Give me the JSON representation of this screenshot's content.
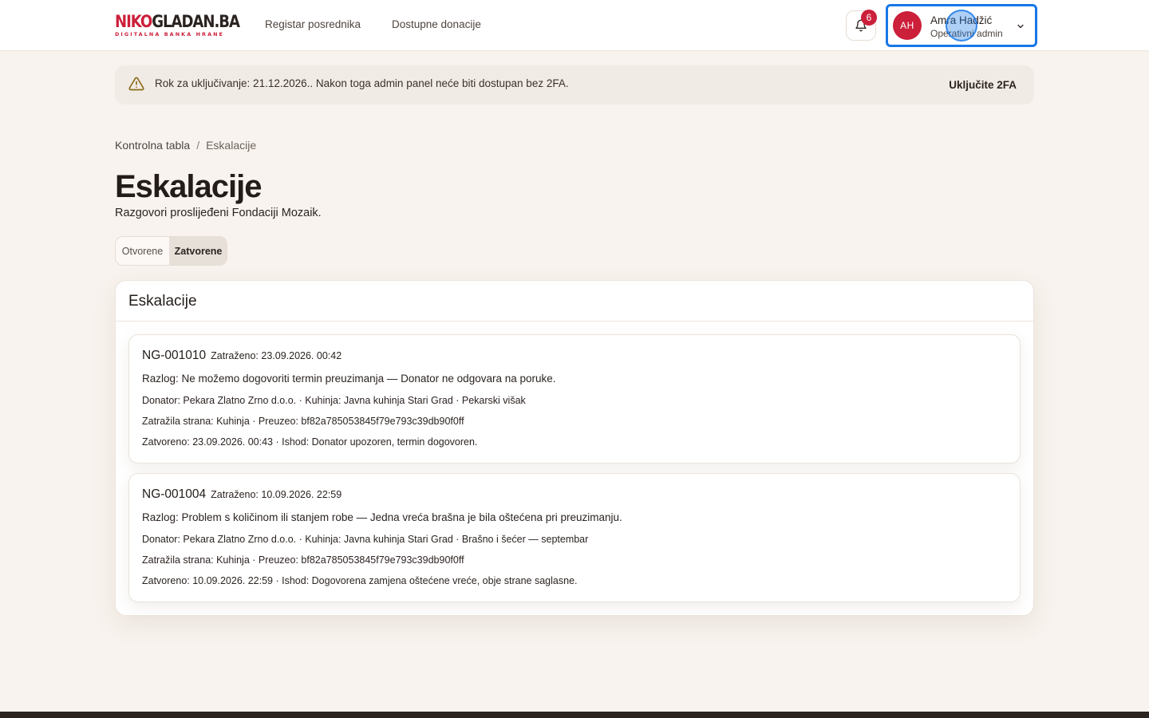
{
  "header": {
    "logo": {
      "part1": "NIKO",
      "part2": "GLADAN.BA",
      "tagline": "DIGITALNA BANKA HRANE"
    },
    "nav": [
      {
        "label": "Registar posrednika"
      },
      {
        "label": "Dostupne donacije"
      }
    ],
    "notifications": {
      "count": "6",
      "icon": "bell-icon"
    },
    "user": {
      "initials": "AH",
      "name": "Amra Hadžić",
      "role": "Operativni admin",
      "icon": "chevron-down-icon"
    }
  },
  "banner": {
    "icon": "warning-icon",
    "text": "Rok za uključivanje: 21.12.2026.. Nakon toga admin panel neće biti dostupan bez 2FA.",
    "action": "Uključite 2FA"
  },
  "breadcrumb": {
    "home": "Kontrolna tabla",
    "separator": "/",
    "current": "Eskalacije"
  },
  "page": {
    "title": "Eskalacije",
    "subtitle": "Razgovori proslijeđeni Fondaciji Mozaik."
  },
  "filters": {
    "tabs": [
      {
        "label": "Otvorene"
      },
      {
        "label": "Zatvorene",
        "selected": true
      }
    ]
  },
  "panel": {
    "title": "Eskalacije",
    "items": [
      {
        "id": "NG-001010",
        "requested": "Zatraženo: 23.09.2026. 00:42",
        "reason": "Razlog: Ne možemo dogovoriti termin preuzimanja — Donator ne odgovara na poruke.",
        "parties": "Donator: Pekara Zlatno Zrno d.o.o. · Kuhinja: Javna kuhinja Stari Grad · Pekarski višak",
        "requester": "Zatražila strana: Kuhinja · Preuzeo: bf82a785053845f79e793c39db90f0ff",
        "closed": "Zatvoreno: 23.09.2026. 00:43 · Ishod: Donator upozoren, termin dogovoren."
      },
      {
        "id": "NG-001004",
        "requested": "Zatraženo: 10.09.2026. 22:59",
        "reason": "Razlog: Problem s količinom ili stanjem robe — Jedna vreća brašna je bila oštećena pri preuzimanju.",
        "parties": "Donator: Pekara Zlatno Zrno d.o.o. · Kuhinja: Javna kuhinja Stari Grad · Brašno i šećer — septembar",
        "requester": "Zatražila strana: Kuhinja · Preuzeo: bf82a785053845f79e793c39db90f0ff",
        "closed": "Zatvoreno: 10.09.2026. 22:59 · Ishod: Dogovorena zamjena oštećene vreće, obje strane saglasne."
      }
    ]
  },
  "colors": {
    "brand": "#cc1f3a",
    "background": "#f8f3ee",
    "focus": "#1877e8"
  }
}
